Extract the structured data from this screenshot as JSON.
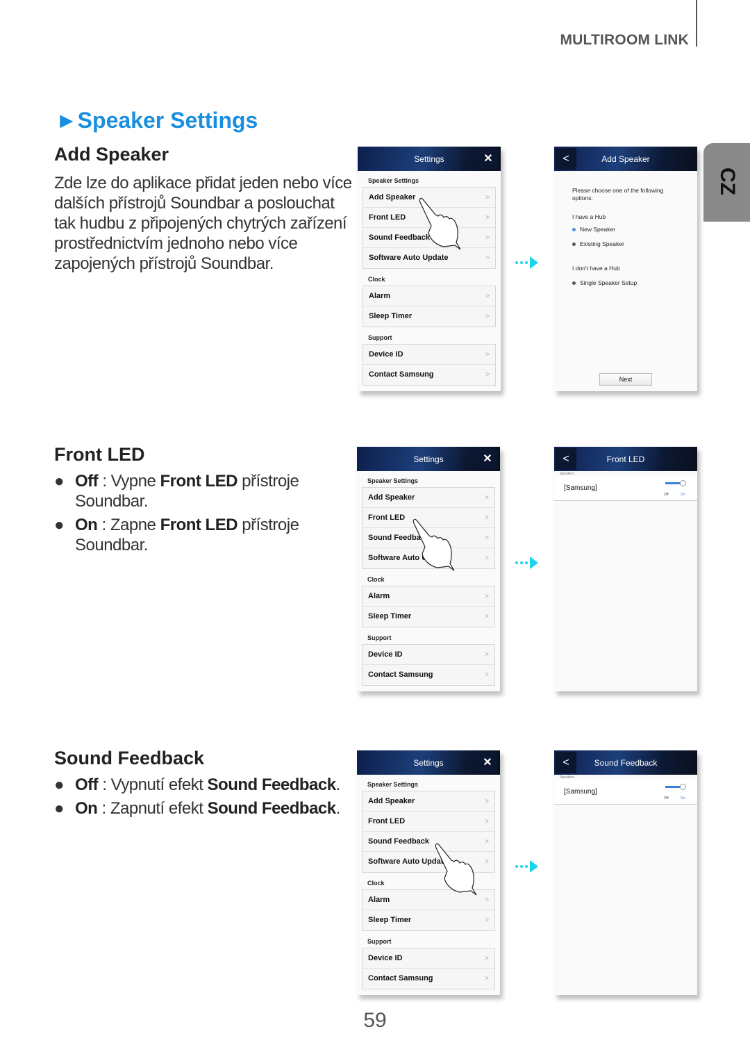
{
  "header": {
    "section": "MULTIROOM LINK",
    "language_tab": "CZ"
  },
  "title": "Speaker Settings",
  "title_marker": "►",
  "colors": {
    "accent": "#1a8fe0",
    "arrow": "#19d3f0",
    "header_dark": "#0d1f4d"
  },
  "sections": [
    {
      "heading": "Add Speaker",
      "text": "Zde lze do aplikace přidat jeden nebo více dalších přístrojů Soundbar a poslouchat tak hudbu z připojených chytrých zařízení prostřednictvím jednoho nebo více zapojených přístrojů Soundbar."
    },
    {
      "heading": "Front LED",
      "bullets": [
        {
          "dot": "●",
          "key": "Off",
          "sep": " : Vypne ",
          "bold": "Front LED",
          "rest": " přístroje Soundbar."
        },
        {
          "dot": "●",
          "key": "On",
          "sep": " : Zapne ",
          "bold": "Front LED",
          "rest": " přístroje Soundbar."
        }
      ]
    },
    {
      "heading": "Sound Feedback",
      "bullets": [
        {
          "dot": "●",
          "key": "Off",
          "sep": " : Vypnutí efekt ",
          "bold": "Sound Feedback",
          "rest": "."
        },
        {
          "dot": "●",
          "key": "On",
          "sep": " : Zapnutí efekt ",
          "bold": "Sound Feedback",
          "rest": "."
        }
      ]
    }
  ],
  "settings_screen": {
    "title": "Settings",
    "close": "✕",
    "chevron": ">",
    "groups": [
      {
        "label": "Speaker Settings",
        "items": [
          "Add Speaker",
          "Front LED",
          "Sound Feedback",
          "Software Auto Update"
        ]
      },
      {
        "label": "Clock",
        "items": [
          "Alarm",
          "Sleep Timer"
        ]
      },
      {
        "label": "Support",
        "items": [
          "Device ID",
          "Contact Samsung"
        ]
      }
    ]
  },
  "add_speaker_screen": {
    "title": "Add Speaker",
    "back": "<",
    "prompt": "Please choose one of the following options:",
    "hub_label": "I have a Hub",
    "hub_options": [
      "New Speaker",
      "Existing Speaker"
    ],
    "nohub_label": "I don't have a Hub",
    "nohub_options": [
      "Single Speaker Setup"
    ],
    "next": "Next"
  },
  "toggle_screens": [
    {
      "title": "Front LED",
      "back": "<",
      "section": "Speakers",
      "device": "[Samsung]",
      "off": "Off",
      "on": "On",
      "state": "On"
    },
    {
      "title": "Sound Feedback",
      "back": "<",
      "section": "Speakers",
      "device": "[Samsung]",
      "off": "Off",
      "on": "On",
      "state": "On"
    }
  ],
  "page_number": "59"
}
